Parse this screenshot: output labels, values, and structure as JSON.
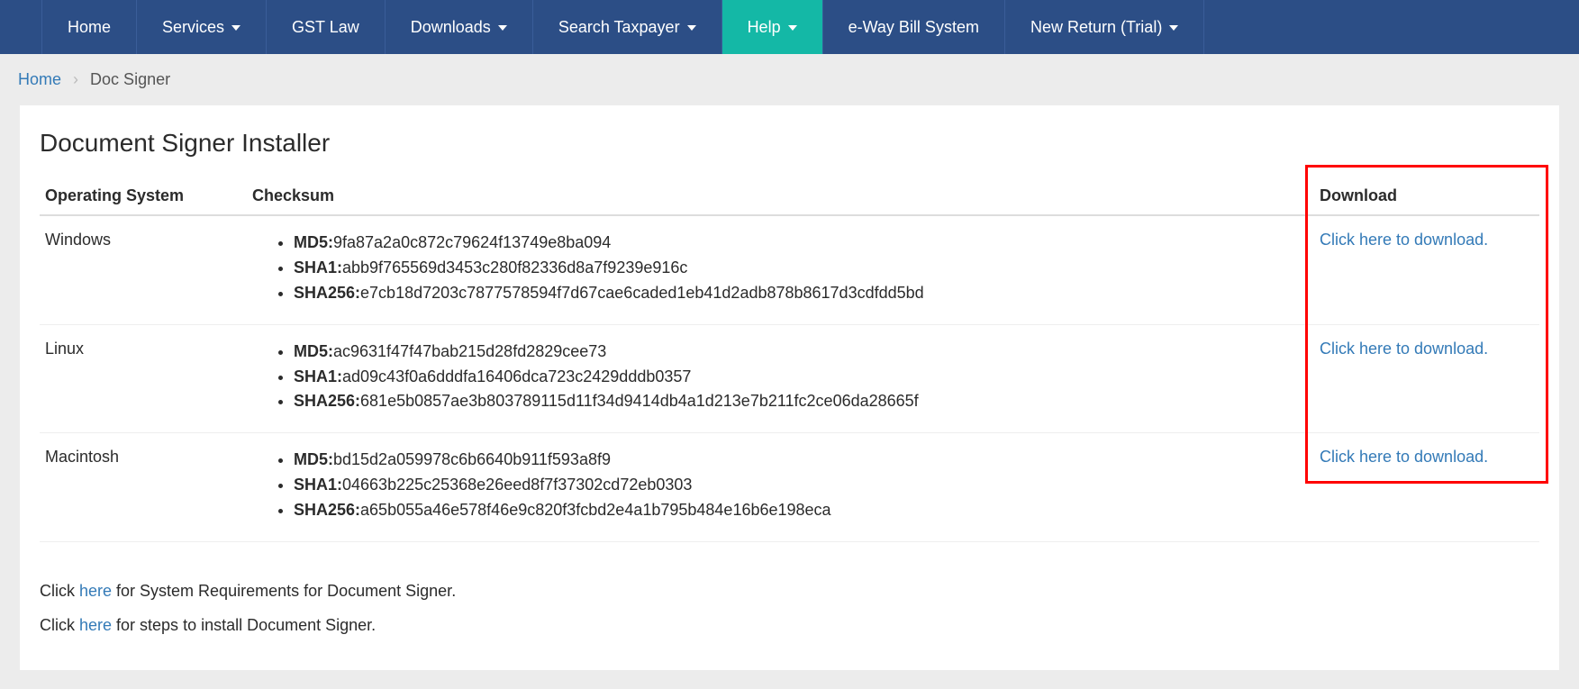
{
  "navbar": {
    "items": [
      {
        "label": "Home",
        "dropdown": false,
        "active": false
      },
      {
        "label": "Services",
        "dropdown": true,
        "active": false
      },
      {
        "label": "GST Law",
        "dropdown": false,
        "active": false
      },
      {
        "label": "Downloads",
        "dropdown": true,
        "active": false
      },
      {
        "label": "Search Taxpayer",
        "dropdown": true,
        "active": false
      },
      {
        "label": "Help",
        "dropdown": true,
        "active": true
      },
      {
        "label": "e-Way Bill System",
        "dropdown": false,
        "active": false
      },
      {
        "label": "New Return (Trial)",
        "dropdown": true,
        "active": false
      }
    ]
  },
  "breadcrumb": {
    "home_label": "Home",
    "separator": "›",
    "current": "Doc Signer"
  },
  "page": {
    "title": "Document Signer Installer",
    "table": {
      "headers": {
        "os": "Operating System",
        "checksum": "Checksum",
        "download": "Download"
      },
      "rows": [
        {
          "os": "Windows",
          "checksums": [
            {
              "label": "MD5:",
              "value": "9fa87a2a0c872c79624f13749e8ba094"
            },
            {
              "label": "SHA1:",
              "value": "abb9f765569d3453c280f82336d8a7f9239e916c"
            },
            {
              "label": "SHA256:",
              "value": "e7cb18d7203c7877578594f7d67cae6caded1eb41d2adb878b8617d3cdfdd5bd"
            }
          ],
          "download_text": "Click here to download."
        },
        {
          "os": "Linux",
          "checksums": [
            {
              "label": "MD5:",
              "value": "ac9631f47f47bab215d28fd2829cee73"
            },
            {
              "label": "SHA1:",
              "value": "ad09c43f0a6dddfa16406dca723c2429dddb0357"
            },
            {
              "label": "SHA256:",
              "value": "681e5b0857ae3b803789115d11f34d9414db4a1d213e7b211fc2ce06da28665f"
            }
          ],
          "download_text": "Click here to download."
        },
        {
          "os": "Macintosh",
          "checksums": [
            {
              "label": "MD5:",
              "value": "bd15d2a059978c6b6640b911f593a8f9"
            },
            {
              "label": "SHA1:",
              "value": "04663b225c25368e26eed8f7f37302cd72eb0303"
            },
            {
              "label": "SHA256:",
              "value": "a65b055a46e578f46e9c820f3fcbd2e4a1b795b484e16b6e198eca"
            }
          ],
          "download_text": "Click here to download."
        }
      ]
    },
    "footer_notes": [
      {
        "prefix": "Click ",
        "link_text": "here",
        "suffix": " for System Requirements for Document Signer."
      },
      {
        "prefix": "Click ",
        "link_text": "here",
        "suffix": " for steps to install Document Signer."
      }
    ]
  }
}
